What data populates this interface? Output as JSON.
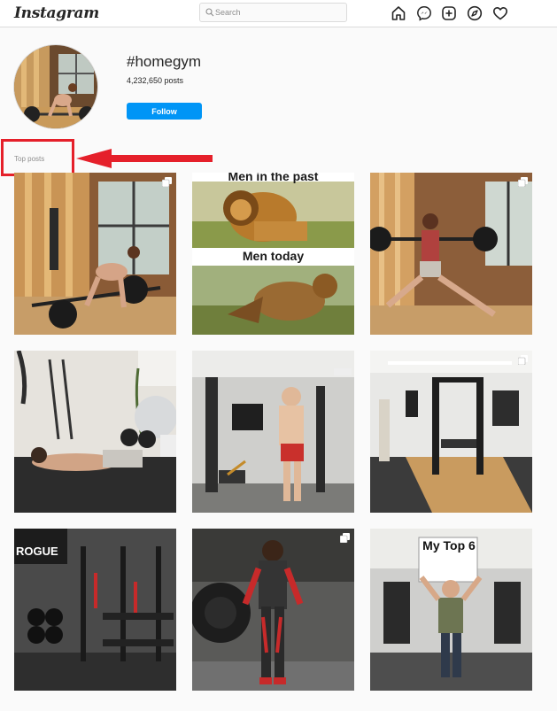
{
  "app": {
    "logo_text": "Instagram"
  },
  "search": {
    "placeholder": "Search",
    "value": ""
  },
  "nav": {
    "icons": [
      "home-icon",
      "messenger-icon",
      "new-post-icon",
      "explore-icon",
      "activity-heart-icon"
    ]
  },
  "hashtag_header": {
    "title": "#homegym",
    "post_count": "4,232,650 posts",
    "follow_label": "Follow"
  },
  "section": {
    "label": "Top posts"
  },
  "annotation": {
    "box_color": "#e5202a",
    "arrow_color": "#e5202a"
  },
  "colors": {
    "follow_blue": "#0095f6",
    "border": "#dbdbdb",
    "background": "#fafafa"
  },
  "posts": [
    {
      "caption_top": "",
      "caption_bottom": "",
      "multi": true
    },
    {
      "caption_top": "Men in the past",
      "caption_bottom": "Men today",
      "multi": false
    },
    {
      "caption_top": "",
      "caption_bottom": "",
      "multi": true
    },
    {
      "caption_top": "",
      "caption_bottom": "",
      "multi": false
    },
    {
      "caption_top": "",
      "caption_bottom": "",
      "multi": false
    },
    {
      "caption_top": "",
      "caption_bottom": "",
      "multi": true
    },
    {
      "caption_top": "ROGUE",
      "caption_bottom": "",
      "multi": false
    },
    {
      "caption_top": "",
      "caption_bottom": "",
      "multi": true
    },
    {
      "caption_top": "My Top 6",
      "caption_bottom": "",
      "multi": false
    }
  ]
}
